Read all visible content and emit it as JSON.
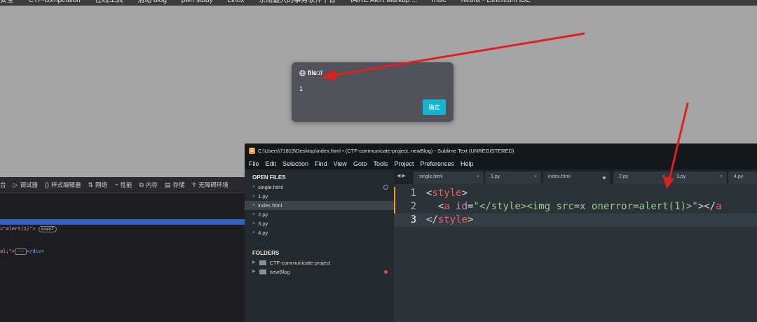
{
  "bookmarks": [
    "安全",
    "CTF-competition",
    "在线工具",
    "活动 blog",
    "pwn study",
    "Linux",
    "东南最大的事务软件平台",
    "fAlRE Alert Markup ...",
    "misc",
    "Netflix - Ethereum IDE"
  ],
  "alert": {
    "origin": "file://",
    "message": "1",
    "ok_label": "确定"
  },
  "devtools": {
    "tabs": [
      {
        "icon": "console-icon",
        "label": "台"
      },
      {
        "icon": "debugger-icon",
        "label": "调试器"
      },
      {
        "icon": "braces-icon",
        "label": "样式编辑器"
      },
      {
        "icon": "network-icon",
        "label": "网络"
      },
      {
        "icon": "performance-icon",
        "label": "性能"
      },
      {
        "icon": "memory-icon",
        "label": "内存"
      },
      {
        "icon": "storage-icon",
        "label": "存储"
      },
      {
        "icon": "accessibility-icon",
        "label": "无障碍环境"
      }
    ],
    "code_line1_str": "=\"alert(1)\">",
    "code_line1_badge": "event",
    "code_line2_a": "al;\">",
    "code_line2_ell": "···",
    "code_line2_b": "</div>"
  },
  "sublime": {
    "title": "C:\\Users\\71819\\Desktop\\index.html • (CTF-communicate-project, newBlog) - Sublime Text (UNREGISTERED)",
    "menu": [
      "File",
      "Edit",
      "Selection",
      "Find",
      "View",
      "Goto",
      "Tools",
      "Project",
      "Preferences",
      "Help"
    ],
    "open_files_heading": "OPEN FILES",
    "open_files": [
      "single.html",
      "1.py",
      "index.html",
      "2.py",
      "3.py",
      "4.py"
    ],
    "folders_heading": "FOLDERS",
    "folders": [
      "CTF-communicate-project",
      "newBlog"
    ],
    "tabs": [
      "single.html",
      "1.py",
      "index.html",
      "2.py",
      "3.py",
      "4.py"
    ],
    "line_numbers": [
      "1",
      "2",
      "3"
    ],
    "code": {
      "l1_open": "<",
      "l1_tag": "style",
      "l1_close": ">",
      "l2_indent": "  ",
      "l2_lt": "<",
      "l2_tag": "a",
      "l2_sp": " ",
      "l2_attr": "id",
      "l2_eq": "=",
      "l2_str": "\"</style><img src=x onerror=alert(1)>\"",
      "l2_gt": ">",
      "l2_close_lt": "</",
      "l2_close_tag": "a",
      "l3_lt": "</",
      "l3_tag": "style",
      "l3_gt": ">"
    }
  },
  "colors": {
    "desktop": "#a6a5a6",
    "alert_button": "#14b4d2",
    "sublime_bg": "#2b3238",
    "arrow": "#e02020"
  }
}
